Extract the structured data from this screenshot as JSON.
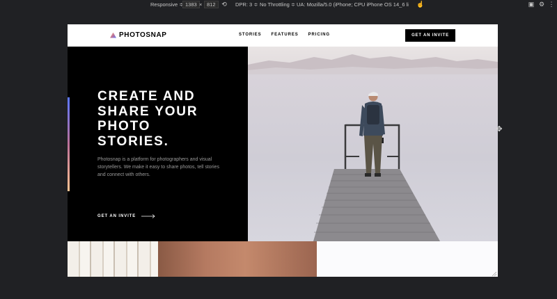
{
  "devtools": {
    "device": "Responsive ≑",
    "width": "1383",
    "times": "×",
    "height": "812",
    "dpr": "DPR: 3 ≑",
    "throttle": "No Throttling ≑",
    "ua": "UA:  Mozilla/5.0 (iPhone; CPU iPhone OS 14_6 li"
  },
  "nav": {
    "logo": "PHOTOSNAP",
    "links": [
      "STORIES",
      "FEATURES",
      "PRICING"
    ],
    "cta": "GET AN INVITE"
  },
  "hero": {
    "title_lines": [
      "CREATE AND",
      "SHARE YOUR",
      "PHOTO",
      "STORIES."
    ],
    "description": "Photosnap is a platform for photographers and visual storytellers. We make it easy to share photos, tell stories and connect with others.",
    "cta": "GET AN INVITE"
  },
  "colors": {
    "accent_gradient": [
      "#5a77ff",
      "#bc7198",
      "#ffc593"
    ],
    "dark": "#000000",
    "white": "#ffffff"
  }
}
